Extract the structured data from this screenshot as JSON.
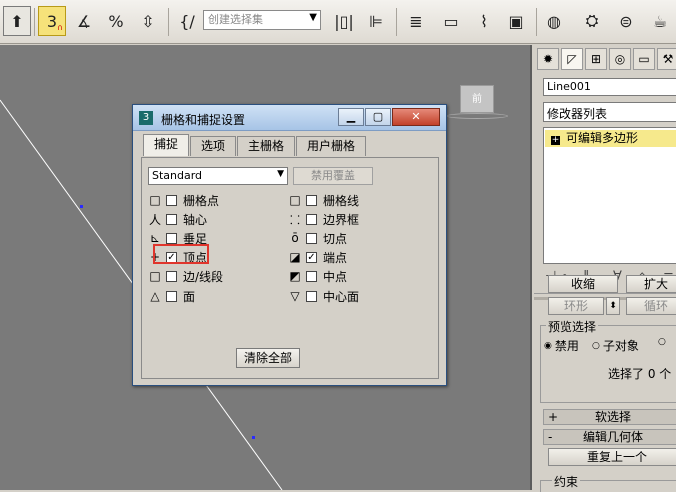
{
  "toolbar": {
    "selection_set_placeholder": "创建选择集",
    "snap_value": "3",
    "icons": [
      "undo-icon",
      "snap-3d-icon",
      "angle-snap-icon",
      "percent-snap-icon",
      "spinner-snap-icon",
      "edit-named-sel-icon",
      "mirror-icon",
      "align-icon",
      "layer-icon",
      "graphite-icon",
      "curve-editor-icon",
      "schematic-icon",
      "material-editor-icon",
      "render-setup-icon",
      "render-icon",
      "teapot-icon"
    ]
  },
  "viewport": {
    "cube_label": "前"
  },
  "dialog": {
    "title": "栅格和捕捉设置",
    "tabs": [
      {
        "label": "捕捉",
        "active": true
      },
      {
        "label": "选项",
        "active": false
      },
      {
        "label": "主栅格",
        "active": false
      },
      {
        "label": "用户栅格",
        "active": false
      }
    ],
    "preset_value": "Standard",
    "override_button": "禁用覆盖",
    "snaps_left": [
      {
        "label": "栅格点",
        "checked": false,
        "icon": "grid-point-icon"
      },
      {
        "label": "轴心",
        "checked": false,
        "icon": "pivot-icon"
      },
      {
        "label": "垂足",
        "checked": false,
        "icon": "perpendicular-icon"
      },
      {
        "label": "顶点",
        "checked": true,
        "icon": "vertex-icon"
      },
      {
        "label": "边/线段",
        "checked": false,
        "icon": "edge-icon"
      },
      {
        "label": "面",
        "checked": false,
        "icon": "face-icon"
      }
    ],
    "snaps_right": [
      {
        "label": "栅格线",
        "checked": false,
        "icon": "grid-line-icon"
      },
      {
        "label": "边界框",
        "checked": false,
        "icon": "bounding-box-icon"
      },
      {
        "label": "切点",
        "checked": false,
        "icon": "tangent-icon"
      },
      {
        "label": "端点",
        "checked": true,
        "icon": "endpoint-icon"
      },
      {
        "label": "中点",
        "checked": false,
        "icon": "midpoint-icon"
      },
      {
        "label": "中心面",
        "checked": false,
        "icon": "center-face-icon"
      }
    ],
    "clear_all_button": "清除全部"
  },
  "command_panel": {
    "object_name": "Line001",
    "modifier_list": "修改器列表",
    "stack_item": "可编辑多边形",
    "shrink_button": "收缩",
    "grow_button": "扩大",
    "ring_button": "环形",
    "loop_button": "循环",
    "preview_group_label": "预览选择",
    "preview_options": [
      "禁用",
      "子对象"
    ],
    "selected_text": "选择了 0 个",
    "soft_selection_rollout": "软选择",
    "edit_geometry_rollout": "编辑几何体",
    "repeat_last_button": "重复上一个",
    "constraint_label": "约束"
  },
  "colors": {
    "viewport_bg": "#7a7a7a",
    "highlight_red": "#e0352c",
    "stack_yellow": "#f6e98c",
    "active_snap_yellow": "#f6e27a"
  }
}
